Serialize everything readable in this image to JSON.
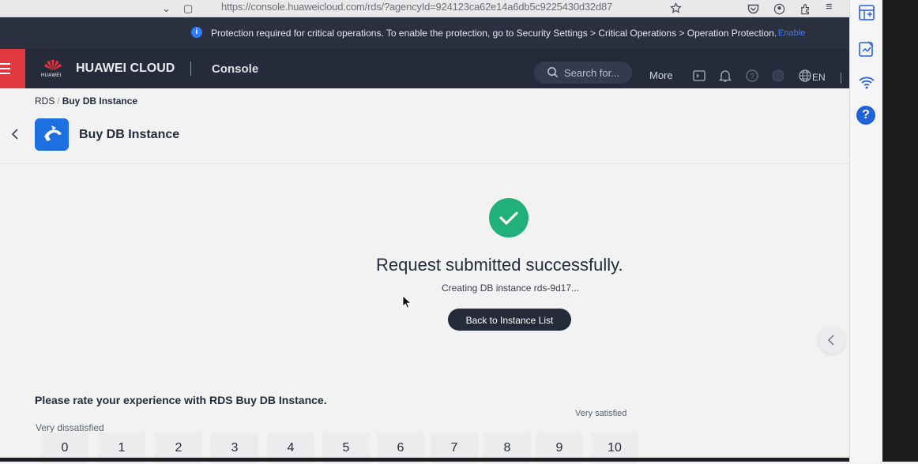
{
  "browser": {
    "url": "https://console.huaweicloud.com/rds/?agencyId=924123ca62e14a6db5c9225430d32d87"
  },
  "notice": {
    "text": "Protection required for critical operations. To enable the protection, go to Security Settings > Critical Operations > Operation Protection.",
    "link": "Enable"
  },
  "header": {
    "logo_text": "HUAWEI",
    "brand": "HUAWEI CLOUD",
    "console": "Console",
    "search_placeholder": "Search for...",
    "more": "More",
    "language": "EN"
  },
  "breadcrumb": {
    "parent": "RDS",
    "separator": "/",
    "current": "Buy DB Instance"
  },
  "page": {
    "title": "Buy DB Instance"
  },
  "result": {
    "title": "Request submitted successfully.",
    "subtitle": "Creating DB instance rds-9d17...",
    "back_button": "Back to Instance List"
  },
  "rating": {
    "question": "Please rate your experience with RDS Buy DB Instance.",
    "low_label": "Very dissatisfied",
    "high_label": "Very satisfied",
    "options": [
      "0",
      "1",
      "2",
      "3",
      "4",
      "5",
      "6",
      "7",
      "8",
      "9",
      "10"
    ]
  },
  "colors": {
    "header_bg": "#252b3a",
    "menu_red": "#e0383e",
    "success_green": "#21b07c",
    "primary_blue": "#1e6fe0"
  }
}
